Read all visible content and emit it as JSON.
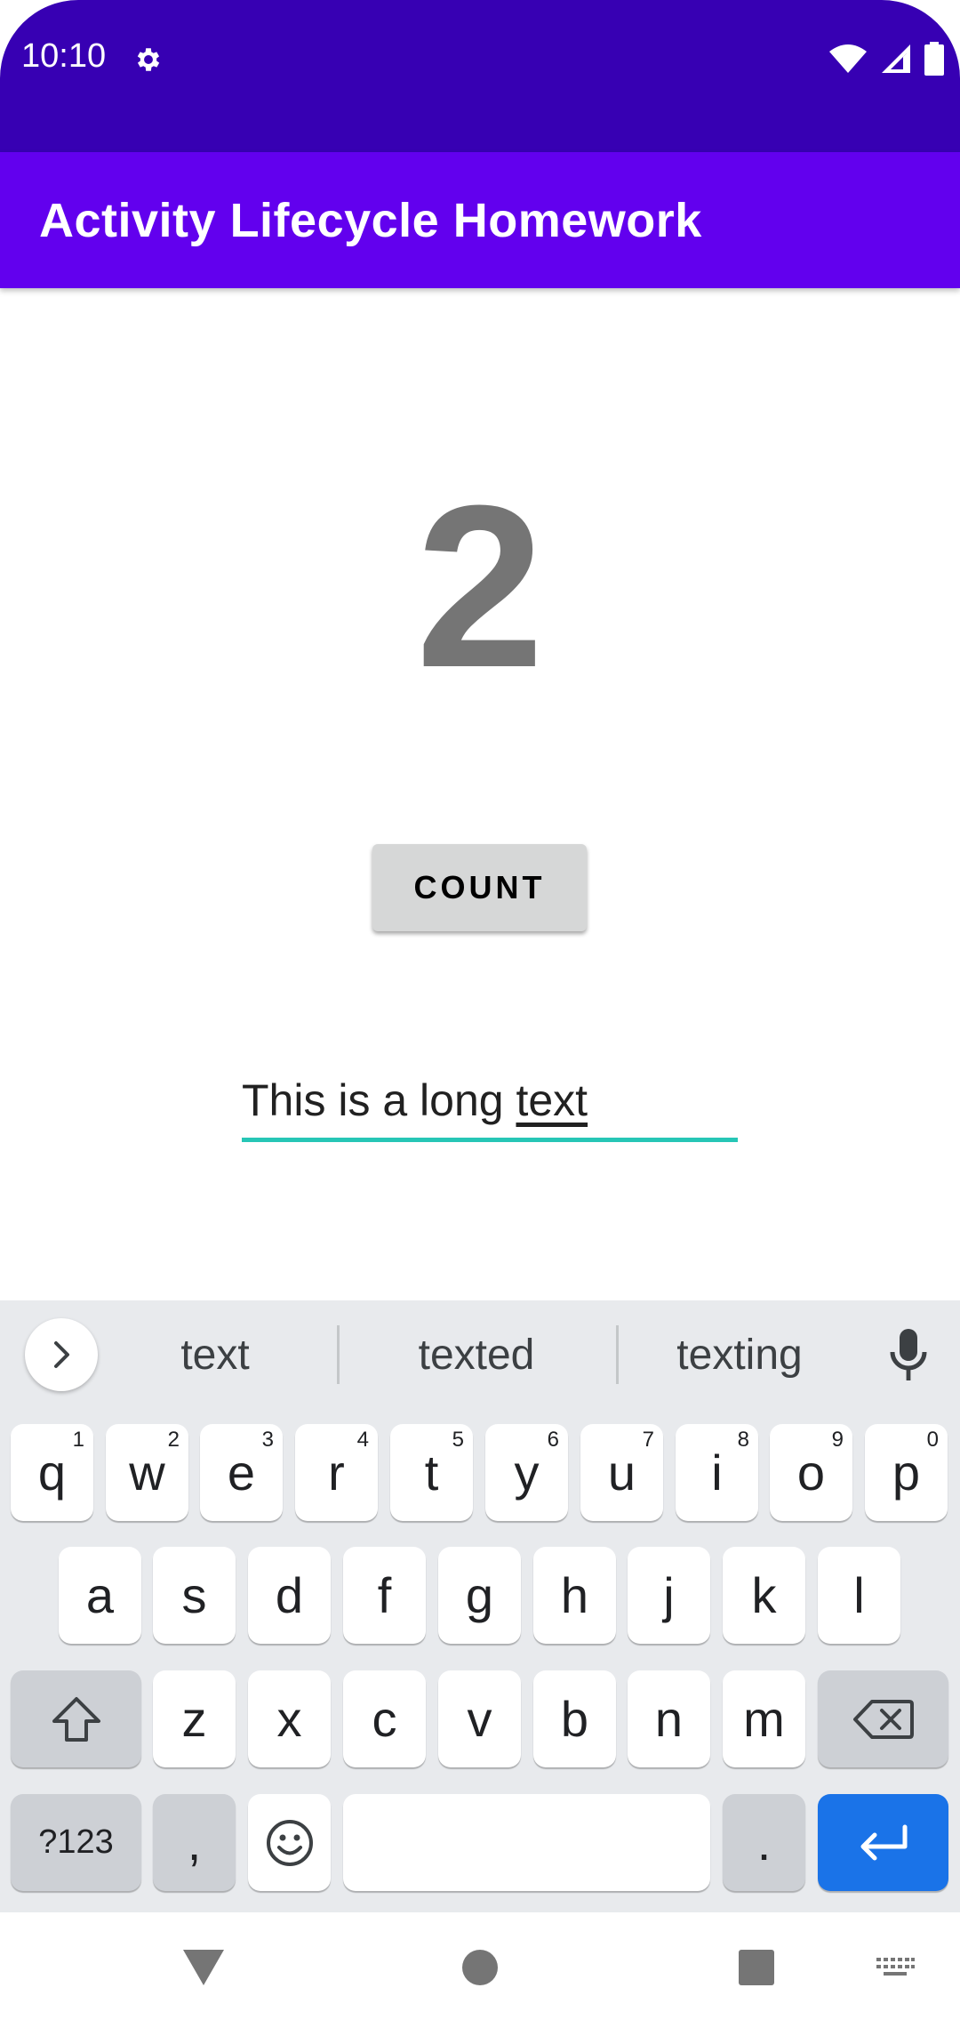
{
  "status_bar": {
    "time": "10:10"
  },
  "app_bar": {
    "title": "Activity Lifecycle Homework"
  },
  "main": {
    "count_value": "2",
    "count_button_label": "COUNT",
    "edit_text_before": "This is a long ",
    "edit_text_composing": "text"
  },
  "keyboard": {
    "suggestions": [
      "text",
      "texted",
      "texting"
    ],
    "row1": [
      {
        "key": "q",
        "hint": "1"
      },
      {
        "key": "w",
        "hint": "2"
      },
      {
        "key": "e",
        "hint": "3"
      },
      {
        "key": "r",
        "hint": "4"
      },
      {
        "key": "t",
        "hint": "5"
      },
      {
        "key": "y",
        "hint": "6"
      },
      {
        "key": "u",
        "hint": "7"
      },
      {
        "key": "i",
        "hint": "8"
      },
      {
        "key": "o",
        "hint": "9"
      },
      {
        "key": "p",
        "hint": "0"
      }
    ],
    "row2": [
      "a",
      "s",
      "d",
      "f",
      "g",
      "h",
      "j",
      "k",
      "l"
    ],
    "row3": [
      "z",
      "x",
      "c",
      "v",
      "b",
      "n",
      "m"
    ],
    "symbols_label": "?123",
    "comma_label": ",",
    "period_label": "."
  },
  "colors": {
    "status_bar": "#3700b3",
    "app_bar": "#6200ee",
    "accent": "#26c6b6",
    "enter_key": "#1a73e8"
  }
}
